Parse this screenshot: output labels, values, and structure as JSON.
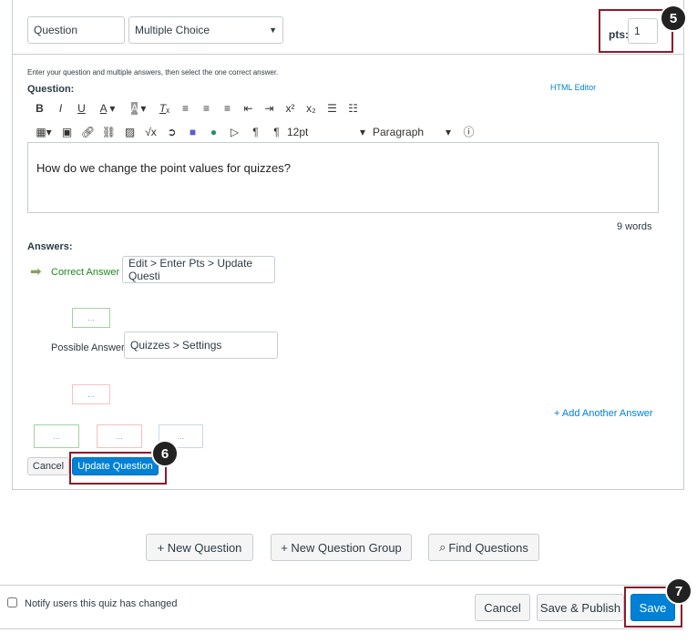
{
  "header": {
    "question_name": "Question",
    "question_type": "Multiple Choice",
    "pts_label": "pts:",
    "pts_value": "1",
    "callout5": "5"
  },
  "instructions": "Enter your question and multiple answers, then select the one correct answer.",
  "question_label": "Question:",
  "html_editor": "HTML Editor",
  "toolbar1": [
    "bold-icon",
    "italic-icon",
    "underline-icon",
    "text-color-icon",
    "background-color-icon",
    "clear-formatting-icon",
    "align-left-icon",
    "align-center-icon",
    "align-right-icon",
    "outdent-icon",
    "indent-icon",
    "superscript-icon",
    "subscript-icon",
    "bullet-list-icon",
    "numbered-list-icon"
  ],
  "toolbar2": [
    "table-icon",
    "media-icon",
    "link-icon",
    "unlink-icon",
    "image-icon",
    "equation-icon",
    "embed-icon",
    "teams-icon",
    "location-icon",
    "record-media-icon",
    "ltr-icon",
    "rtl-icon"
  ],
  "font_size": "12pt",
  "block_format": "Paragraph",
  "question_text": "How do we change the point values for quizzes?",
  "word_count": "9 words",
  "answers_label": "Answers:",
  "correct_answer_label": "Correct Answer",
  "correct_answer_value": "Edit > Enter Pts > Update Questi",
  "possible_answer_label": "Possible Answer",
  "possible_answer_value": "Quizzes > Settings",
  "dots": "...",
  "add_answer": "+ Add Another Answer",
  "cancel": "Cancel",
  "update_question": "Update Question",
  "callout6": "6",
  "actions": {
    "new_question": "+ New Question",
    "new_group": "+ New Question Group",
    "find": "Find Questions"
  },
  "footer": {
    "notify": "Notify users this quiz has changed",
    "notify_checked": false,
    "cancel": "Cancel",
    "save_publish": "Save & Publish",
    "save": "Save",
    "callout7": "7"
  }
}
